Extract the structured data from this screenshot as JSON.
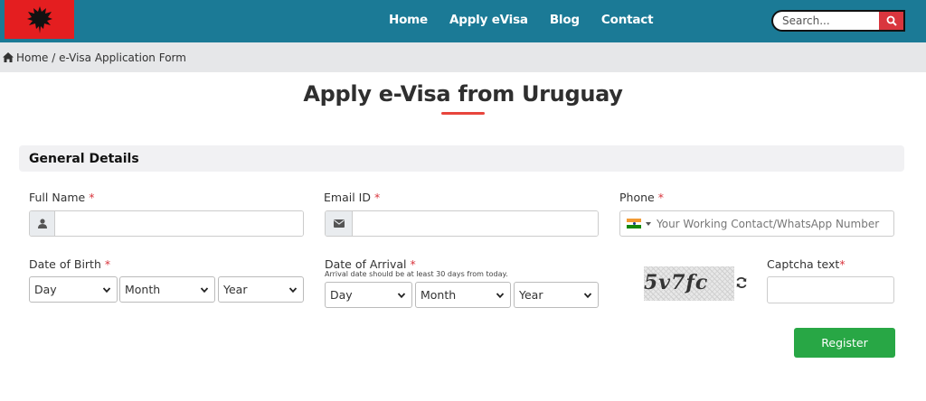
{
  "header": {
    "nav": [
      {
        "label": "Home"
      },
      {
        "label": "Apply eVisa"
      },
      {
        "label": "Blog"
      },
      {
        "label": "Contact"
      }
    ],
    "search": {
      "placeholder": "Search...",
      "icon": "search-icon"
    },
    "brand_color": "#1b7a96",
    "logo": "albania-flag"
  },
  "breadcrumb": {
    "home": "Home",
    "separator": "/",
    "current": "e-Visa Application Form"
  },
  "page": {
    "title": "Apply e-Visa from Uruguay",
    "accent": "#e8453c"
  },
  "section": {
    "title": "General Details"
  },
  "fields": {
    "full_name": {
      "label": "Full Name",
      "required": "*",
      "icon": "user-icon",
      "value": ""
    },
    "email": {
      "label": "Email ID",
      "required": "*",
      "icon": "envelope-icon",
      "value": ""
    },
    "phone": {
      "label": "Phone",
      "required": "*",
      "placeholder": "Your Working Contact/WhatsApp Number",
      "country": "india-flag"
    },
    "dob": {
      "label": "Date of Birth",
      "required": "*",
      "day": "Day",
      "month": "Month",
      "year": "Year"
    },
    "arrival": {
      "label": "Date of Arrival",
      "required": "*",
      "hint": "Arrival date should be at least 30 days from today.",
      "day": "Day",
      "month": "Month",
      "year": "Year"
    },
    "captcha": {
      "image_text": "5v7fc",
      "label": "Captcha text",
      "required": "*",
      "refresh_icon": "refresh-icon",
      "value": ""
    }
  },
  "actions": {
    "register": "Register",
    "register_color": "#28a745"
  }
}
